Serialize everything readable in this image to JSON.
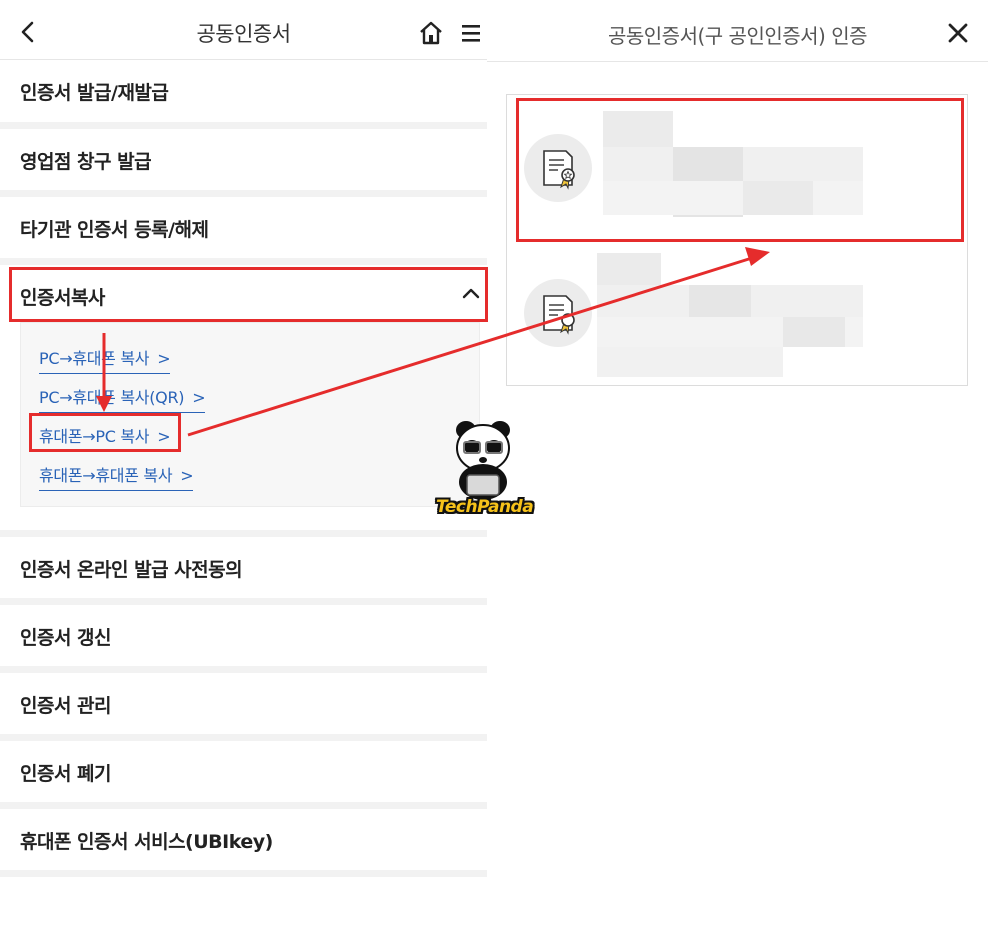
{
  "left": {
    "header": {
      "title": "공동인증서"
    },
    "menu": [
      {
        "label": "인증서 발급/재발급"
      },
      {
        "label": "영업점 창구 발급"
      },
      {
        "label": "타기관 인증서 등록/해제"
      },
      {
        "label": "인증서복사"
      },
      {
        "label": "인증서 온라인 발급 사전동의"
      },
      {
        "label": "인증서 갱신"
      },
      {
        "label": "인증서 관리"
      },
      {
        "label": "인증서 폐기"
      },
      {
        "label": "휴대폰 인증서 서비스(UBIkey)"
      }
    ],
    "submenu": [
      {
        "label": "PC→휴대폰 복사"
      },
      {
        "label": "PC→휴대폰 복사(QR)"
      },
      {
        "label": "휴대폰→PC 복사"
      },
      {
        "label": "휴대폰→휴대폰 복사"
      }
    ],
    "submenu_arrow": ">"
  },
  "right": {
    "header": {
      "title": "공동인증서(구 공인인증서) 인증"
    },
    "certificates": [
      {
        "icon": "certificate-icon"
      },
      {
        "icon": "certificate-icon"
      }
    ]
  },
  "watermark": {
    "text": "TechPanda"
  },
  "colors": {
    "highlight": "#e52c2c",
    "link": "#2a63b7",
    "separator": "#f2f2f2",
    "ribbon": "#f0c53a"
  }
}
